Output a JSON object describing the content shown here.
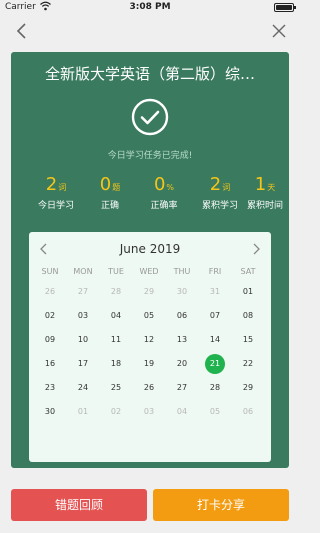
{
  "status_bar": {
    "carrier": "Carrier",
    "time": "3:08 PM"
  },
  "card": {
    "title": "全新版大学英语（第二版）综…",
    "done_text": "今日学习任务已完成!",
    "stats": [
      {
        "value": "2",
        "unit": "词",
        "label": "今日学习"
      },
      {
        "value": "0",
        "unit": "题",
        "label": "正确"
      },
      {
        "value": "0",
        "unit": "%",
        "label": "正确率"
      },
      {
        "value": "2",
        "unit": "词",
        "label": "累积学习"
      },
      {
        "value": "1",
        "unit": "天",
        "label": "累积时间"
      }
    ]
  },
  "calendar": {
    "month": "June 2019",
    "weekdays": [
      "SUN",
      "MON",
      "TUE",
      "WED",
      "THU",
      "FRI",
      "SAT"
    ],
    "weeks": [
      [
        "26",
        "27",
        "28",
        "29",
        "30",
        "31",
        "01"
      ],
      [
        "02",
        "03",
        "04",
        "05",
        "06",
        "07",
        "08"
      ],
      [
        "09",
        "10",
        "11",
        "12",
        "13",
        "14",
        "15"
      ],
      [
        "16",
        "17",
        "18",
        "19",
        "20",
        "21",
        "22"
      ],
      [
        "23",
        "24",
        "25",
        "26",
        "27",
        "28",
        "29"
      ],
      [
        "30",
        "01",
        "02",
        "03",
        "04",
        "05",
        "06"
      ]
    ],
    "today": "21"
  },
  "buttons": {
    "review": "错题回顾",
    "share": "打卡分享"
  },
  "colors": {
    "card": "#3a7a5f",
    "accent": "#f5c518",
    "today": "#20b24f",
    "review": "#e45252",
    "share": "#f39c12"
  }
}
